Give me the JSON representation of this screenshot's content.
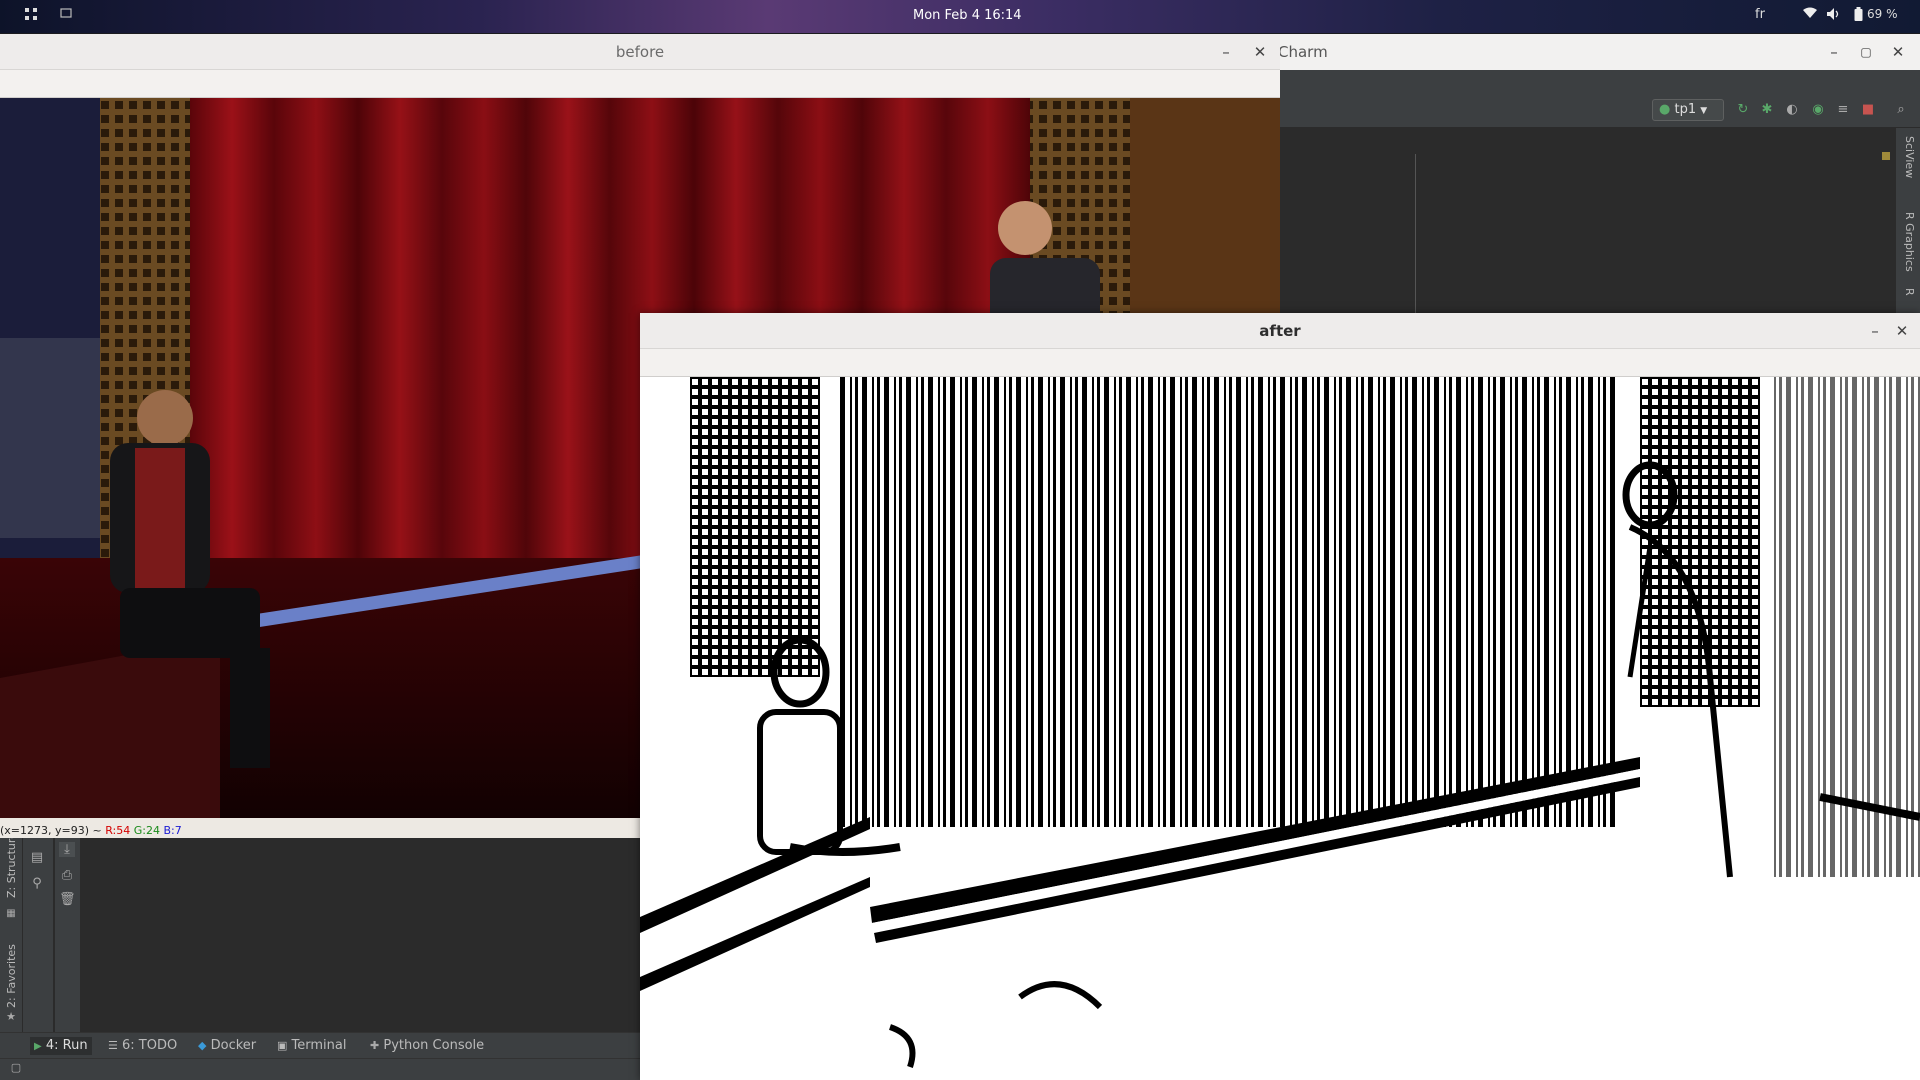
{
  "topbar": {
    "clock": "Mon Feb 4  16:14",
    "lang": "fr",
    "battery": "69 %"
  },
  "pycharm": {
    "title": "PyCharm",
    "title_visible": "Charm",
    "run_config": "tp1",
    "side_tools": [
      "SciView",
      "R Graphics",
      "R"
    ]
  },
  "before_window": {
    "title": "before",
    "status": {
      "coords": "(x=1273, y=93) ~",
      "r": "R:54",
      "g": "G:24",
      "b": "B:7"
    }
  },
  "after_window": {
    "title": "after"
  },
  "ide_bottom": {
    "vertical_tabs": [
      "Z: Structure",
      "2: Favorites"
    ],
    "tabs": [
      {
        "label": "4: Run",
        "icon": "run-icon"
      },
      {
        "label": "6: TODO",
        "icon": "todo-list-icon"
      },
      {
        "label": "Docker",
        "icon": "docker-icon"
      },
      {
        "label": "Terminal",
        "icon": "terminal-icon"
      },
      {
        "label": "Python Console",
        "icon": "python-console-icon"
      }
    ]
  },
  "colors": {
    "topbar_accent": "#5a3a74",
    "ide_dark": "#2b2b2b",
    "ide_panel": "#3c3f41",
    "curtain_red": "#7a0a10",
    "status_r": "#d40000",
    "status_g": "#1a8a1a",
    "status_b": "#1a1ad4"
  }
}
